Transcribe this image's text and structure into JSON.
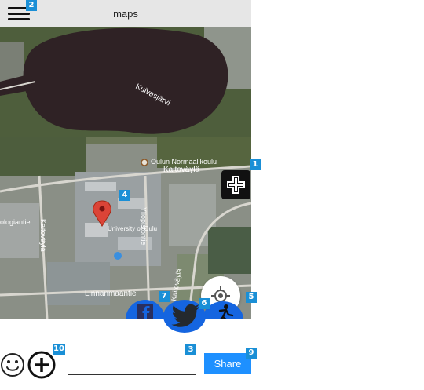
{
  "app": {
    "title": "maps"
  },
  "badges": {
    "firstaid": "1",
    "menu": "2",
    "input": "3",
    "pin": "4",
    "locate": "5",
    "twitter": "6",
    "facebook": "7",
    "share": "9",
    "plus": "10"
  },
  "map": {
    "lake_label": "Kuivasjärvi",
    "school_label": "Oulun Normaalikoulu",
    "district_label": "Kaitoväylä",
    "pin_label": "University of Oulu",
    "street_kaitovayla": "Kaitoväylä",
    "street_linnanmaantie": "Linnanmaantie",
    "street_yliopistontie": "Yliopistontie",
    "street_ologiantie": "ologiantie",
    "street_tie": "Kaitoväylä",
    "pin_color": "#db4437"
  },
  "composer": {
    "input_value": "",
    "input_placeholder": "",
    "share_label": "Share"
  },
  "colors": {
    "accent": "#1e90ff",
    "social": "#1565e0",
    "badge": "#1a8fd6"
  },
  "icons": [
    "menu-icon",
    "first-aid-icon",
    "crosshair-icon",
    "facebook-icon",
    "twitter-icon",
    "running-person-icon",
    "smiley-icon",
    "plus-circle-icon",
    "map-pin-icon"
  ]
}
